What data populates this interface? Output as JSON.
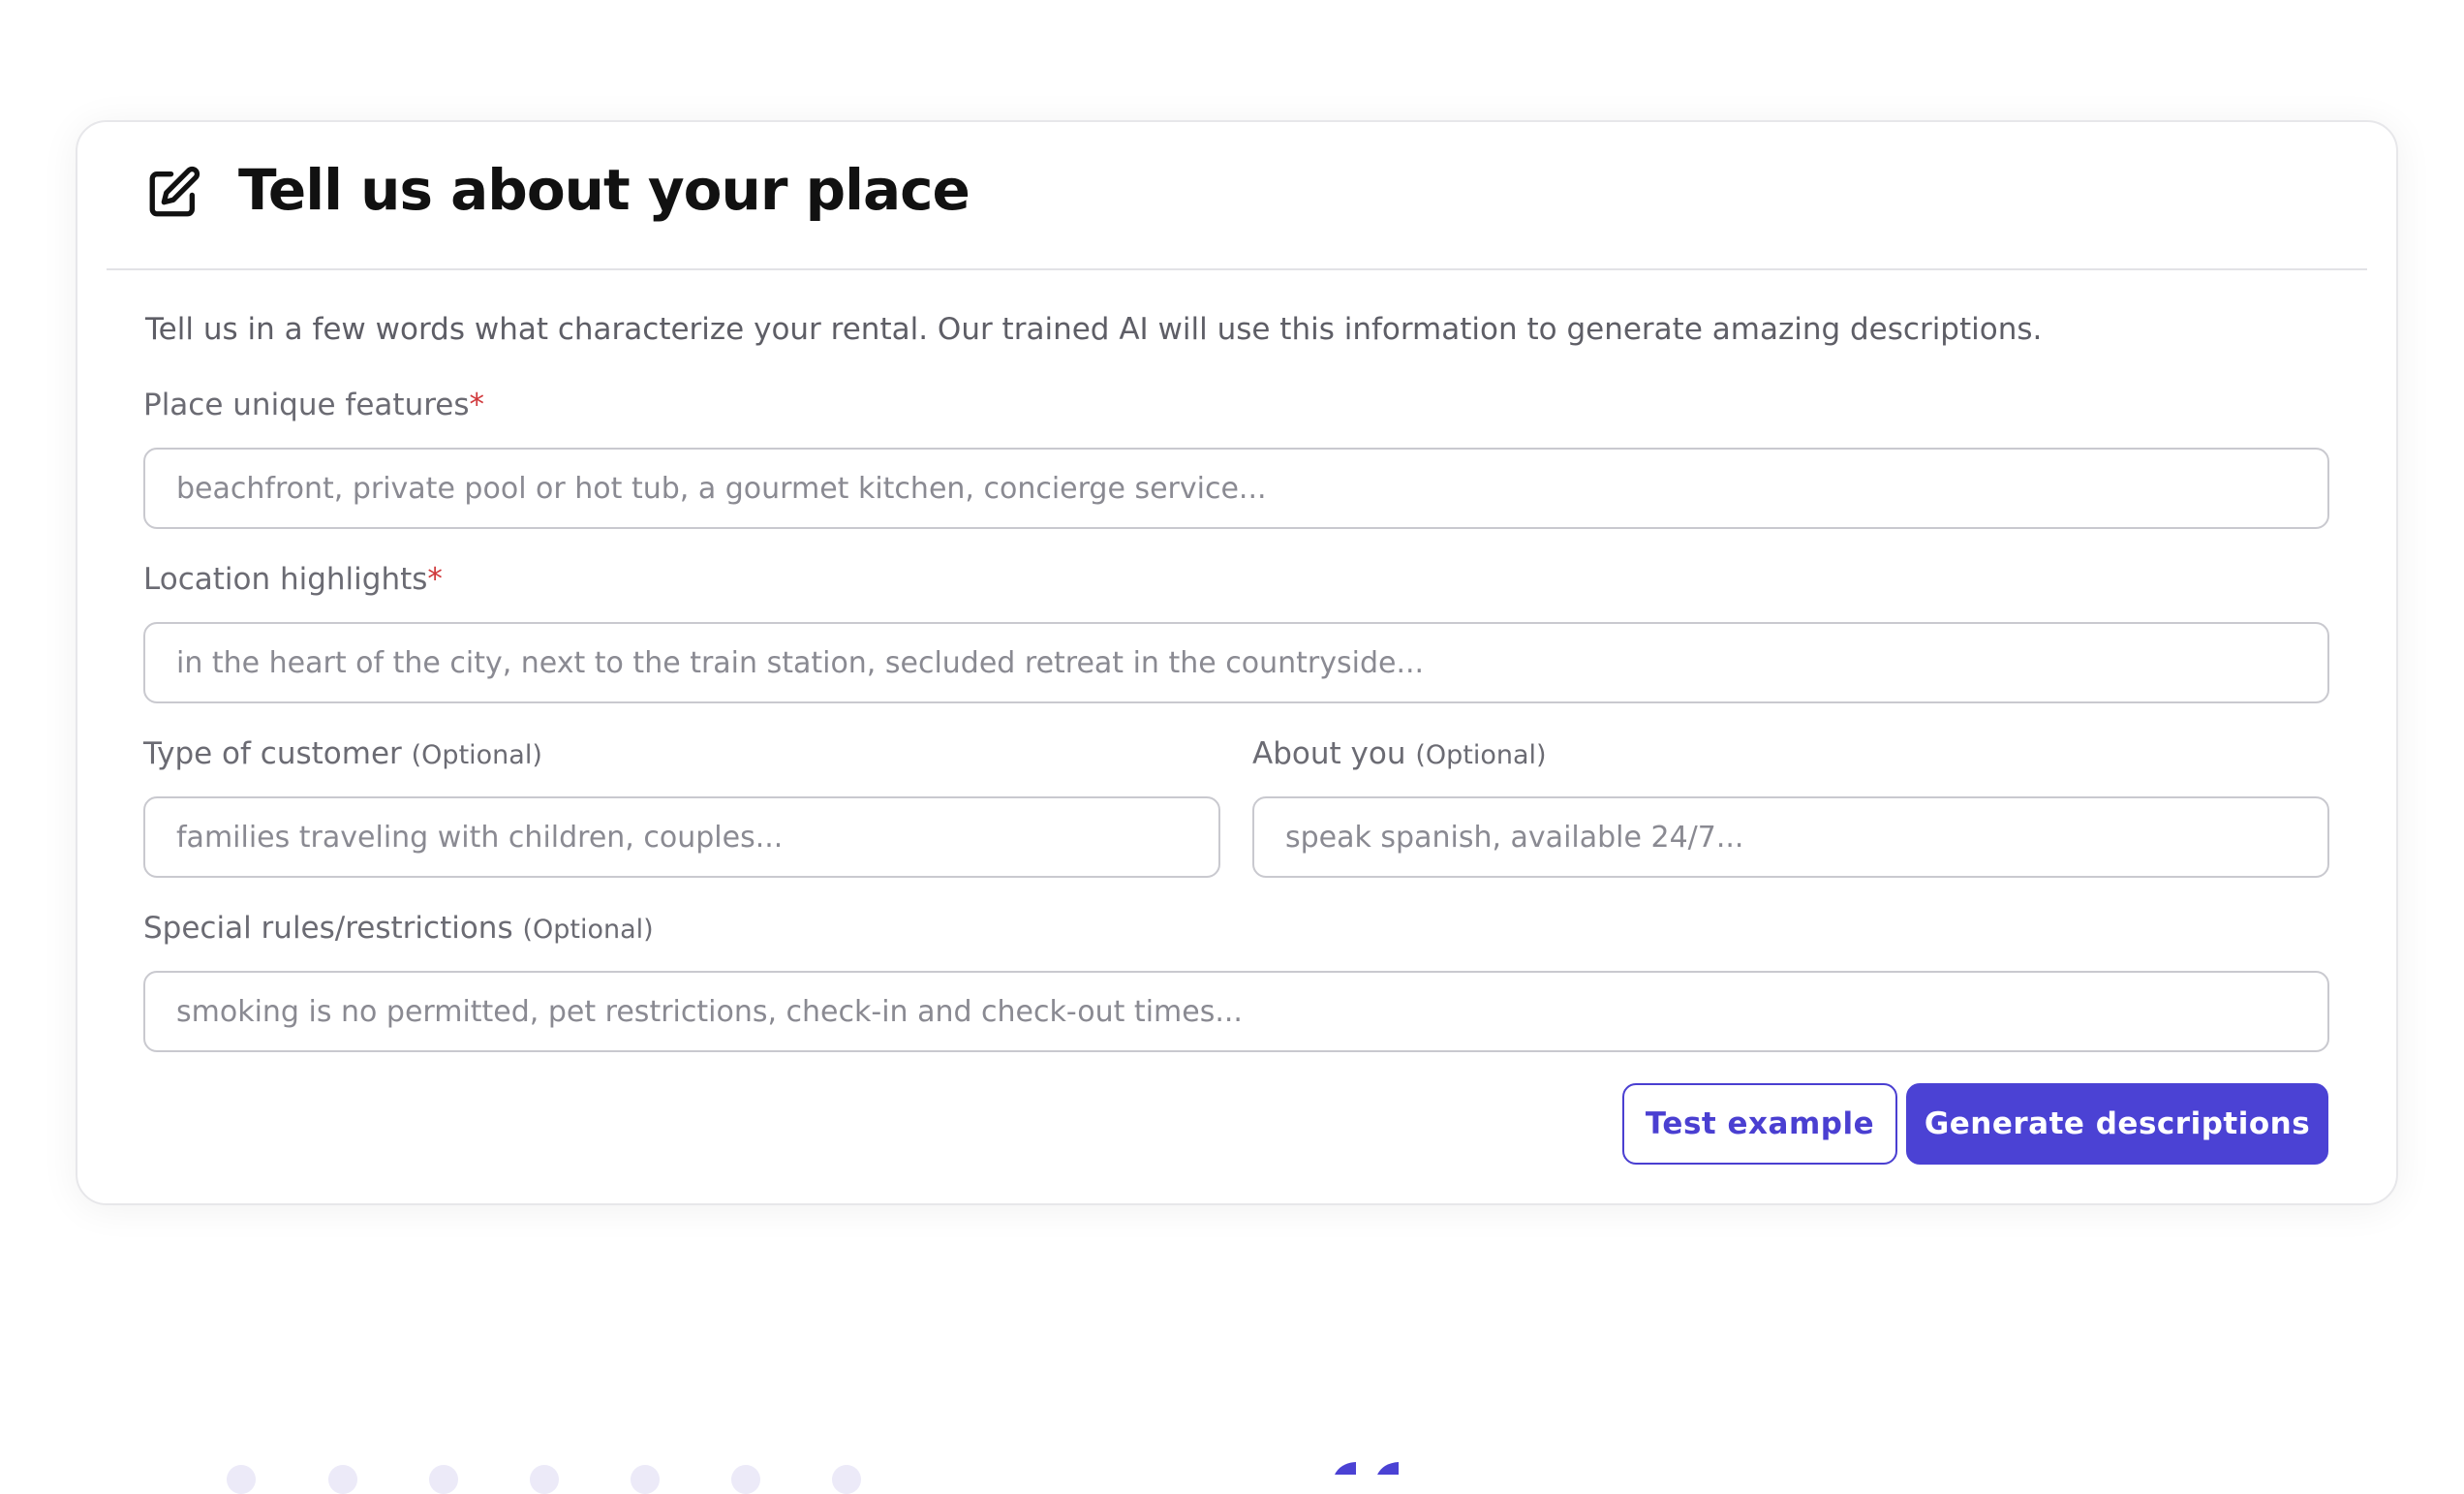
{
  "card": {
    "title": "Tell us about your place",
    "title_icon": "edit-square-icon",
    "intro": "Tell us in a few words what characterize your rental. Our trained AI will use this information to generate amazing descriptions."
  },
  "fields": {
    "features": {
      "label": "Place unique features",
      "required_mark": "*",
      "placeholder": "beachfront, private pool or hot tub, a gourmet kitchen, concierge service...",
      "value": ""
    },
    "location": {
      "label": "Location highlights",
      "required_mark": "*",
      "placeholder": "in the heart of the city, next to the train station, secluded retreat in the countryside...",
      "value": ""
    },
    "customer": {
      "label": "Type of customer",
      "optional_text": "(Optional)",
      "placeholder": "families traveling with children, couples...",
      "value": ""
    },
    "about": {
      "label": "About you",
      "optional_text": "(Optional)",
      "placeholder": "speak spanish, available 24/7...",
      "value": ""
    },
    "rules": {
      "label": "Special rules/restrictions",
      "optional_text": "(Optional)",
      "placeholder": "smoking is no permitted, pet restrictions, check-in and check-out times...",
      "value": ""
    }
  },
  "buttons": {
    "test_example": "Test example",
    "generate": "Generate descriptions"
  },
  "colors": {
    "accent": "#4b42d4",
    "required": "#d0383b"
  }
}
